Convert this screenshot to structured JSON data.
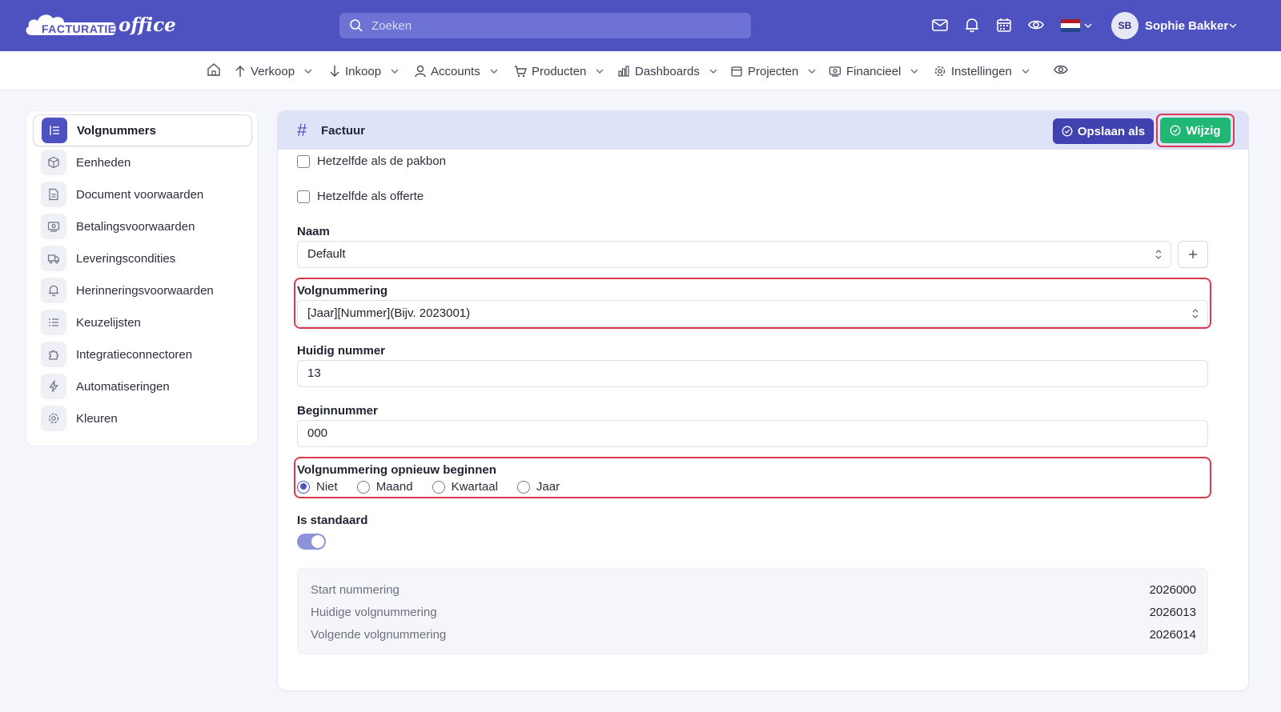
{
  "brand": {
    "name": "FACTURATIE",
    "suffix": "office"
  },
  "search": {
    "placeholder": "Zoeken"
  },
  "topbar": {
    "icons": [
      "mail-icon",
      "bell-icon",
      "calendar-icon",
      "eye-icon"
    ],
    "language": "nl-flag",
    "user": {
      "initials": "SB",
      "name": "Sophie Bakker"
    }
  },
  "nav": {
    "items": [
      {
        "label": "Verkoop",
        "icon": "arrow-up-icon"
      },
      {
        "label": "Inkoop",
        "icon": "arrow-down-icon"
      },
      {
        "label": "Accounts",
        "icon": "user-icon"
      },
      {
        "label": "Producten",
        "icon": "cart-icon"
      },
      {
        "label": "Dashboards",
        "icon": "bar-chart-icon"
      },
      {
        "label": "Projecten",
        "icon": "calendar-icon"
      },
      {
        "label": "Financieel",
        "icon": "money-icon"
      },
      {
        "label": "Instellingen",
        "icon": "gear-icon"
      }
    ]
  },
  "sidebar": {
    "items": [
      {
        "label": "Volgnummers",
        "icon": "numbered-list-icon",
        "active": true
      },
      {
        "label": "Eenheden",
        "icon": "cube-icon"
      },
      {
        "label": "Document voorwaarden",
        "icon": "document-icon"
      },
      {
        "label": "Betalingsvoorwaarden",
        "icon": "money-icon"
      },
      {
        "label": "Leveringscondities",
        "icon": "truck-icon"
      },
      {
        "label": "Herinneringsvoorwaarden",
        "icon": "bell-icon"
      },
      {
        "label": "Keuzelijsten",
        "icon": "list-icon"
      },
      {
        "label": "Integratieconnectoren",
        "icon": "puzzle-icon"
      },
      {
        "label": "Automatiseringen",
        "icon": "bolt-icon"
      },
      {
        "label": "Kleuren",
        "icon": "gear-icon"
      }
    ]
  },
  "card": {
    "title": "Factuur",
    "save_as_label": "Opslaan als",
    "edit_label": "Wijzig",
    "checkbox_pakbon": "Hetzelfde als de pakbon",
    "checkbox_offerte": "Hetzelfde als offerte",
    "naam_label": "Naam",
    "naam_value": "Default",
    "volgnummering_label": "Volgnummering",
    "volgnummering_value": "[Jaar][Nummer](Bijv. 2023001)",
    "huidig_label": "Huidig nummer",
    "huidig_value": "13",
    "begin_label": "Beginnummer",
    "begin_value": "000",
    "restart_label": "Volgnummering opnieuw beginnen",
    "restart_options": [
      "Niet",
      "Maand",
      "Kwartaal",
      "Jaar"
    ],
    "restart_selected": "Niet",
    "standaard_label": "Is standaard",
    "standaard_on": true,
    "summary": [
      {
        "key": "Start nummering",
        "value": "2026000"
      },
      {
        "key": "Huidige volgnummering",
        "value": "2026013"
      },
      {
        "key": "Volgende volgnummering",
        "value": "2026014"
      }
    ],
    "colors": {
      "primary": "#4e52c0",
      "success": "#20b673",
      "highlight": "#d83a50"
    }
  }
}
